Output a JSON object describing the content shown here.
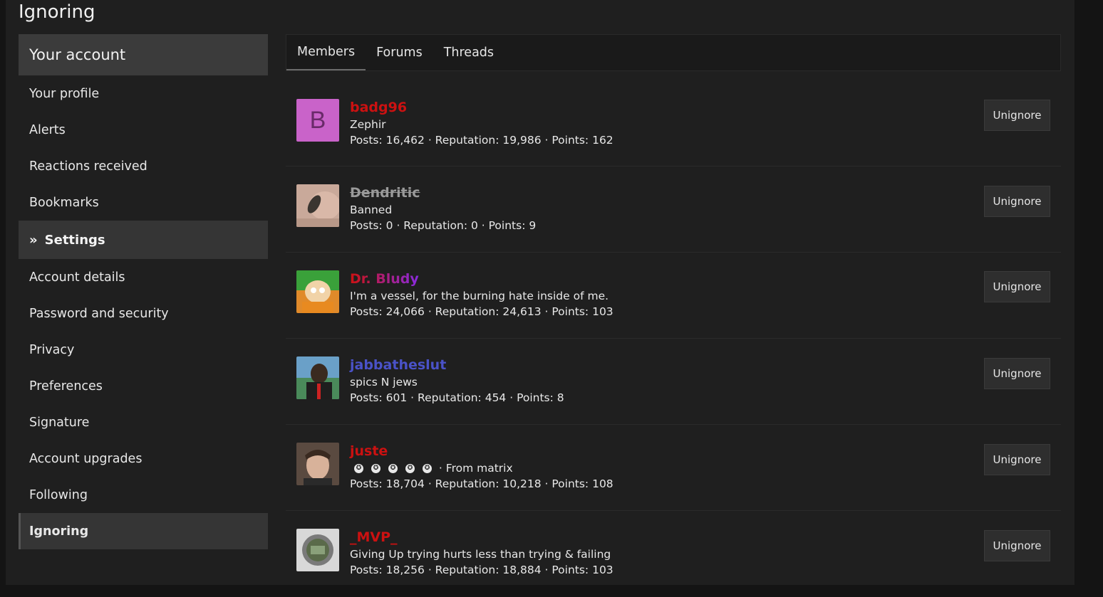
{
  "page": {
    "title": "Ignoring"
  },
  "sidebar": {
    "header": "Your account",
    "account_items": [
      {
        "label": "Your profile"
      },
      {
        "label": "Alerts"
      },
      {
        "label": "Reactions received"
      },
      {
        "label": "Bookmarks"
      }
    ],
    "settings_section": "Settings",
    "settings_items": [
      {
        "label": "Account details"
      },
      {
        "label": "Password and security"
      },
      {
        "label": "Privacy"
      },
      {
        "label": "Preferences"
      },
      {
        "label": "Signature"
      },
      {
        "label": "Account upgrades"
      },
      {
        "label": "Following"
      },
      {
        "label": "Ignoring",
        "active": true
      }
    ]
  },
  "tabs": [
    {
      "label": "Members",
      "active": true
    },
    {
      "label": "Forums"
    },
    {
      "label": "Threads"
    }
  ],
  "button_label": "Unignore",
  "members": [
    {
      "username": "badg96",
      "name_color": "#cc1111",
      "title": "Zephir",
      "stats": "Posts: 16,462 · Reputation: 19,986 · Points: 162",
      "avatar_letter": "B",
      "avatar_color": "#c963c9"
    },
    {
      "username": "Dendritic",
      "banned": true,
      "title": "Banned",
      "stats": "Posts: 0 · Reputation: 0 · Points: 9"
    },
    {
      "username": "Dr. Bludy",
      "name_gradient": [
        "#cc1111",
        "#8a2be2"
      ],
      "title": "I'm a vessel, for the burning hate inside of me.",
      "stats": "Posts: 24,066 · Reputation: 24,613 · Points: 103"
    },
    {
      "username": "jabbatheslut",
      "name_color": "#4a52c8",
      "title": "spics N jews",
      "stats": "Posts: 601 · Reputation: 454 · Points: 8"
    },
    {
      "username": "juste",
      "name_color": "#cc1111",
      "title": "From matrix",
      "title_stars": 5,
      "stats": "Posts: 18,704 · Reputation: 10,218 · Points: 108"
    },
    {
      "username": "_MVP_",
      "name_color": "#cc1111",
      "title": "Giving Up trying hurts less than trying & failing",
      "stats": "Posts: 18,256 · Reputation: 18,884 · Points: 103"
    }
  ]
}
